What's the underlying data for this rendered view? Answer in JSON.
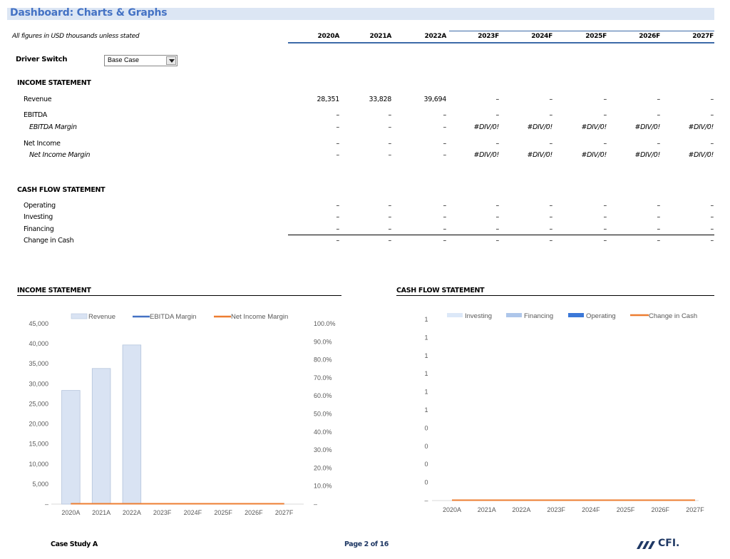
{
  "header": {
    "title": "Dashboard: Charts & Graphs",
    "subtitle": "All figures in USD thousands unless stated",
    "years": [
      "2020A",
      "2021A",
      "2022A",
      "2023F",
      "2024F",
      "2025F",
      "2026F",
      "2027F"
    ]
  },
  "driver": {
    "label": "Driver Switch",
    "value": "Base Case"
  },
  "income_statement": {
    "title": "INCOME STATEMENT",
    "rows": [
      {
        "label": "Revenue",
        "italic": false,
        "values": [
          "28,351",
          "33,828",
          "39,694",
          "–",
          "–",
          "–",
          "–",
          "–"
        ]
      },
      {
        "label": "EBITDA",
        "italic": false,
        "values": [
          "–",
          "–",
          "–",
          "–",
          "–",
          "–",
          "–",
          "–"
        ]
      },
      {
        "label": "EBITDA Margin",
        "italic": true,
        "values": [
          "–",
          "–",
          "–",
          "#DIV/0!",
          "#DIV/0!",
          "#DIV/0!",
          "#DIV/0!",
          "#DIV/0!"
        ]
      },
      {
        "label": "Net Income",
        "italic": false,
        "values": [
          "–",
          "–",
          "–",
          "–",
          "–",
          "–",
          "–",
          "–"
        ]
      },
      {
        "label": "Net Income Margin",
        "italic": true,
        "values": [
          "–",
          "–",
          "–",
          "#DIV/0!",
          "#DIV/0!",
          "#DIV/0!",
          "#DIV/0!",
          "#DIV/0!"
        ]
      }
    ]
  },
  "cash_flow_statement": {
    "title": "CASH FLOW STATEMENT",
    "rows": [
      {
        "label": "Operating",
        "values": [
          "–",
          "–",
          "–",
          "–",
          "–",
          "–",
          "–",
          "–"
        ]
      },
      {
        "label": "Investing",
        "values": [
          "–",
          "–",
          "–",
          "–",
          "–",
          "–",
          "–",
          "–"
        ]
      },
      {
        "label": "Financing",
        "values": [
          "–",
          "–",
          "–",
          "–",
          "–",
          "–",
          "–",
          "–"
        ]
      },
      {
        "label": "Change in Cash",
        "values": [
          "–",
          "–",
          "–",
          "–",
          "–",
          "–",
          "–",
          "–"
        ]
      }
    ]
  },
  "colors": {
    "title_blue": "#4472c4",
    "title_bg": "#dce6f4",
    "revenue_bar": "#d9e3f3",
    "ebitda_line": "#4472c4",
    "net_income_line": "#ed7d31",
    "investing": "#dce8f8",
    "financing": "#aec6ea",
    "operating": "#3b78d8",
    "change_in_cash": "#ed7d31"
  },
  "chart_data": [
    {
      "type": "bar",
      "title": "INCOME STATEMENT",
      "categories": [
        "2020A",
        "2021A",
        "2022A",
        "2023F",
        "2024F",
        "2025F",
        "2026F",
        "2027F"
      ],
      "series": [
        {
          "name": "Revenue",
          "kind": "bar",
          "axis": "left",
          "values": [
            28351,
            33828,
            39694,
            0,
            0,
            0,
            0,
            0
          ]
        },
        {
          "name": "EBITDA Margin",
          "kind": "line",
          "axis": "right",
          "values": [
            0,
            0,
            0,
            0,
            0,
            0,
            0,
            0
          ]
        },
        {
          "name": "Net Income Margin",
          "kind": "line",
          "axis": "right",
          "values": [
            0,
            0,
            0,
            0,
            0,
            0,
            0,
            0
          ]
        }
      ],
      "ylim": [
        0,
        45000
      ],
      "yticks": [
        "–",
        "5,000",
        "10,000",
        "15,000",
        "20,000",
        "25,000",
        "30,000",
        "35,000",
        "40,000",
        "45,000"
      ],
      "y2lim": [
        0,
        1.0
      ],
      "y2ticks": [
        "–",
        "10.0%",
        "20.0%",
        "30.0%",
        "40.0%",
        "50.0%",
        "60.0%",
        "70.0%",
        "80.0%",
        "90.0%",
        "100.0%"
      ],
      "legend": "top",
      "grid": false
    },
    {
      "type": "bar",
      "title": "CASH FLOW STATEMENT",
      "categories": [
        "2020A",
        "2021A",
        "2022A",
        "2023F",
        "2024F",
        "2025F",
        "2026F",
        "2027F"
      ],
      "series": [
        {
          "name": "Investing",
          "kind": "bar",
          "values": [
            0,
            0,
            0,
            0,
            0,
            0,
            0,
            0
          ]
        },
        {
          "name": "Financing",
          "kind": "bar",
          "values": [
            0,
            0,
            0,
            0,
            0,
            0,
            0,
            0
          ]
        },
        {
          "name": "Operating",
          "kind": "bar",
          "values": [
            0,
            0,
            0,
            0,
            0,
            0,
            0,
            0
          ]
        },
        {
          "name": "Change in Cash",
          "kind": "line",
          "values": [
            0,
            0,
            0,
            0,
            0,
            0,
            0,
            0
          ]
        }
      ],
      "ylim": [
        0,
        1
      ],
      "yticks": [
        "–",
        "0",
        "0",
        "0",
        "0",
        "1",
        "1",
        "1",
        "1",
        "1",
        "1"
      ],
      "legend": "top",
      "grid": false
    }
  ],
  "footer": {
    "left": "Case Study A",
    "center": "Page 2 of 16",
    "logo_text": "CFI."
  }
}
